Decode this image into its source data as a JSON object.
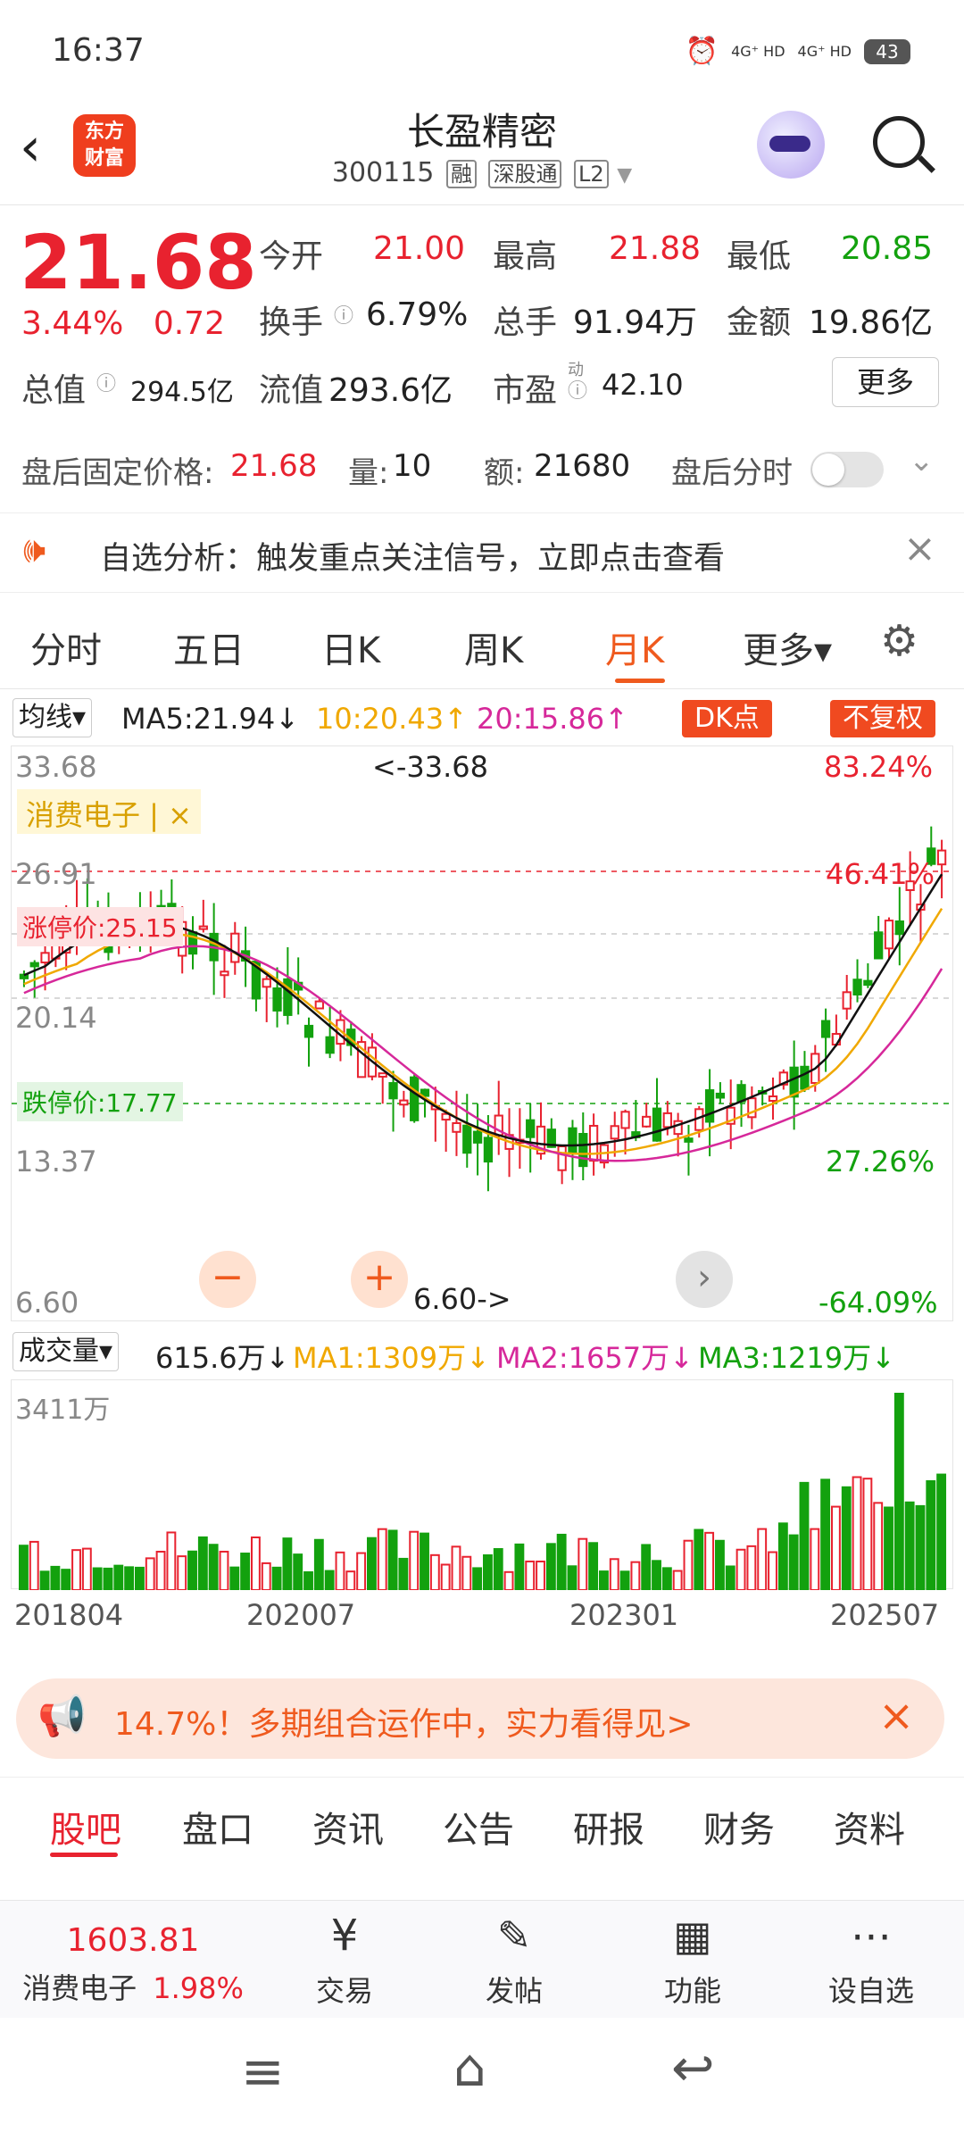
{
  "status": {
    "time": "16:37",
    "net1": "4G⁺ HD",
    "net2": "4G⁺ HD",
    "battery": "43"
  },
  "header": {
    "logo_text1": "东方",
    "logo_text2": "财富",
    "title": "长盈精密",
    "code": "300115",
    "tags": [
      "融",
      "深股通",
      "L2"
    ]
  },
  "quote": {
    "price": "21.68",
    "change_pct": "3.44%",
    "change": "0.72",
    "open_label": "今开",
    "open": "21.00",
    "high_label": "最高",
    "high": "21.88",
    "low_label": "最低",
    "low": "20.85",
    "turnover_label": "换手",
    "turnover": "6.79%",
    "vol_label": "总手",
    "vol": "91.94万",
    "amount_label": "金额",
    "amount": "19.86亿",
    "mktcap_label": "总值",
    "mktcap": "294.5亿",
    "float_label": "流值",
    "float": "293.6亿",
    "pe_label": "市盈",
    "pe_sup": "动",
    "pe": "42.10",
    "more": "更多"
  },
  "after_hours": {
    "label": "盘后固定价格:",
    "price": "21.68",
    "vol_label": "量:",
    "vol": "10",
    "amt_label": "额:",
    "amt": "21680",
    "fenshi": "盘后分时"
  },
  "notice": {
    "text": "自选分析：触发重点关注信号，立即点击查看"
  },
  "chart_tabs": [
    "分时",
    "五日",
    "日K",
    "周K",
    "月K",
    "更多▾"
  ],
  "ma": {
    "selector": "均线",
    "ma5": "MA5:21.94↓",
    "ma10": "10:20.43↑",
    "ma20": "20:15.86↑",
    "dk": "DK点",
    "fq": "不复权"
  },
  "kline": {
    "y_labels": [
      "33.68",
      "26.91",
      "20.14",
      "13.37",
      "6.60"
    ],
    "max_marker": "<-33.68",
    "min_marker": "6.60->",
    "pct_top": "83.24%",
    "pct_mid": "46.41%",
    "pct_low": "27.26%",
    "pct_bottom": "-64.09%",
    "sector_tag": "消费电子 | ×",
    "limit_up": "涨停价:25.15",
    "limit_down": "跌停价:17.77"
  },
  "volume": {
    "selector": "成交量",
    "value": "615.6万↓",
    "ma1": "MA1:1309万↓",
    "ma2": "MA2:1657万↓",
    "ma3": "MA3:1219万↓",
    "max": "3411万",
    "x_labels": [
      "201804",
      "202007",
      "202301",
      "202507"
    ]
  },
  "promo": {
    "text": "14.7%！多期组合运作中，实力看得见>"
  },
  "bottom_tabs": [
    "股吧",
    "盘口",
    "资讯",
    "公告",
    "研报",
    "财务",
    "资料"
  ],
  "dock": {
    "index_value": "1603.81",
    "index_name": "消费电子",
    "index_pct": "1.98%",
    "items": [
      "交易",
      "发帖",
      "功能",
      "设自选"
    ]
  },
  "colors": {
    "up": "#e8222f",
    "down": "#13a10e",
    "accent": "#ef5a1e",
    "ma5": "#111111",
    "ma10": "#f0a800",
    "ma20": "#d6289a"
  }
}
